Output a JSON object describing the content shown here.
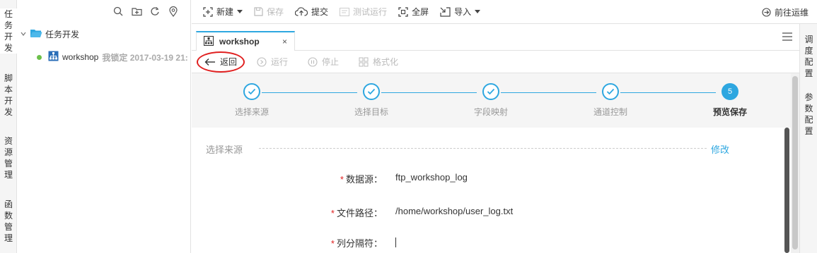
{
  "left_nav": {
    "items": [
      {
        "chars": [
          "任",
          "务",
          "开",
          "发"
        ]
      },
      {
        "chars": [
          "脚",
          "本",
          "开",
          "发"
        ]
      },
      {
        "chars": [
          "资",
          "源",
          "管",
          "理"
        ]
      },
      {
        "chars": [
          "函",
          "数",
          "管",
          "理"
        ]
      }
    ]
  },
  "tree": {
    "folder_label": "任务开发",
    "node_label": "workshop",
    "node_lock_info": "我锁定 2017-03-19 21:"
  },
  "toolbar": {
    "new_label": "新建",
    "save_label": "保存",
    "submit_label": "提交",
    "test_run_label": "测试运行",
    "fullscreen_label": "全屏",
    "import_label": "导入",
    "goto_ops_label": "前往运维"
  },
  "tab": {
    "title": "workshop",
    "close": "×"
  },
  "subbar": {
    "back_label": "返回",
    "run_label": "运行",
    "stop_label": "停止",
    "format_label": "格式化"
  },
  "steps": [
    {
      "label": "选择来源",
      "state": "done"
    },
    {
      "label": "选择目标",
      "state": "done"
    },
    {
      "label": "字段映射",
      "state": "done"
    },
    {
      "label": "通道控制",
      "state": "done"
    },
    {
      "label": "预览保存",
      "state": "current",
      "number": "5"
    }
  ],
  "form": {
    "section_title": "选择来源",
    "edit_label": "修改",
    "rows": [
      {
        "label": "数据源：",
        "value": "ftp_workshop_log"
      },
      {
        "label": "文件路径：",
        "value": "/home/workshop/user_log.txt"
      },
      {
        "label": "列分隔符：",
        "value": ""
      }
    ]
  },
  "right_nav": {
    "items": [
      {
        "chars": [
          "调",
          "度",
          "配",
          "置"
        ]
      },
      {
        "chars": [
          "参",
          "数",
          "配",
          "置"
        ]
      }
    ]
  },
  "colors": {
    "accent": "#2ea7e0",
    "required_star": "#e02020",
    "annotation_circle": "#e02020",
    "status_dot": "#6cc04a"
  }
}
